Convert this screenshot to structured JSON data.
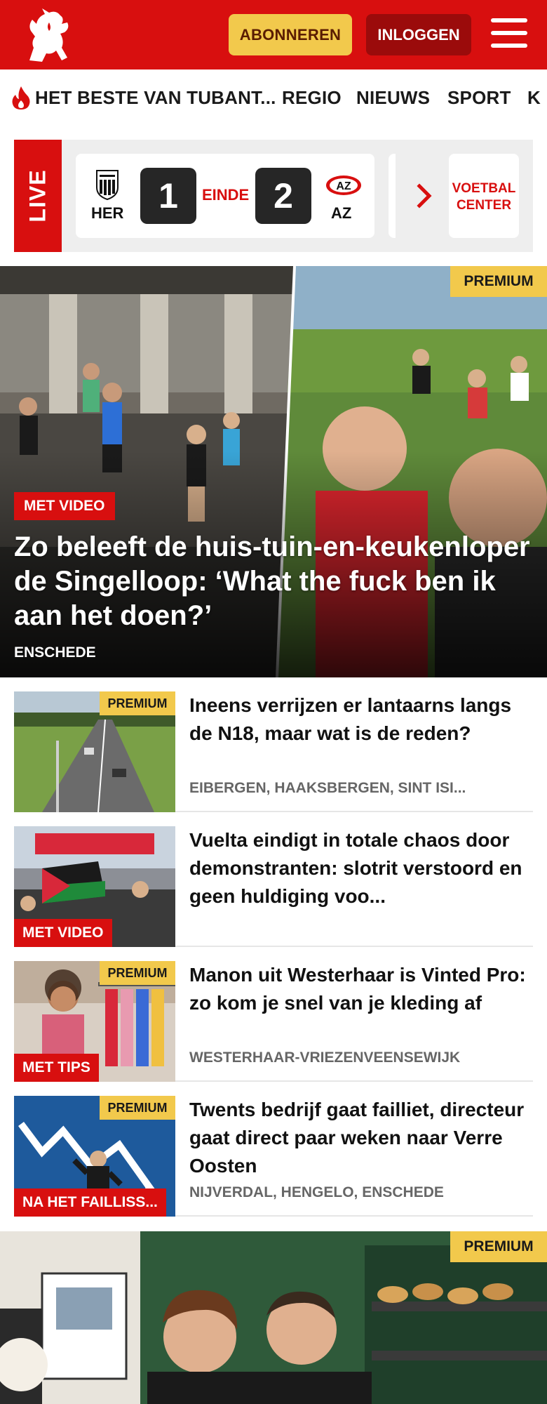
{
  "header": {
    "subscribe_label": "ABONNEREN",
    "login_label": "INLOGGEN",
    "brand_color": "#d80f0f",
    "accent_color": "#f2c94c"
  },
  "nav": {
    "items": [
      {
        "label": "HET BESTE VAN TUBANT..."
      },
      {
        "label": "REGIO"
      },
      {
        "label": "NIEUWS"
      },
      {
        "label": "SPORT"
      },
      {
        "label": "K"
      }
    ]
  },
  "live": {
    "label": "LIVE",
    "home_team": "HER",
    "away_team": "AZ",
    "home_score": "1",
    "away_score": "2",
    "status": "EINDE",
    "voetbal_center": "VOETBAL CENTER"
  },
  "hero": {
    "badge": "PREMIUM",
    "tag": "MET VIDEO",
    "title": "Zo beleeft de huis-tuin-en-keukenlo­per de Singelloop: ‘What the fuck ben ik aan het doen?’",
    "location": "ENSCHEDE"
  },
  "articles": [
    {
      "badge": "PREMIUM",
      "tag": "",
      "title": "Ineens verrijzen er lantaarns langs de N18, maar wat is de reden?",
      "location": "EIBERGEN, HAAKSBERGEN, SINT ISI..."
    },
    {
      "badge": "",
      "tag": "MET VIDEO",
      "title": "Vuelta eindigt in totale chaos door demonstranten: slotrit verstoord en geen huldiging voo...",
      "location": ""
    },
    {
      "badge": "PREMIUM",
      "tag": "MET TIPS",
      "title": "Manon uit Westerhaar is Vinted Pro: zo kom je snel van je kleding af",
      "location": "WESTERHAAR-VRIEZENVEENSEWIJK"
    },
    {
      "badge": "PREMIUM",
      "tag": "NA HET FAILLISS...",
      "title": "Twents bedrijf gaat failliet, directeur gaat direct paar weken naar Verre Oosten",
      "location": "NIJVERDAL, HENGELO, ENSCHEDE"
    }
  ],
  "hero2": {
    "badge": "PREMIUM"
  }
}
